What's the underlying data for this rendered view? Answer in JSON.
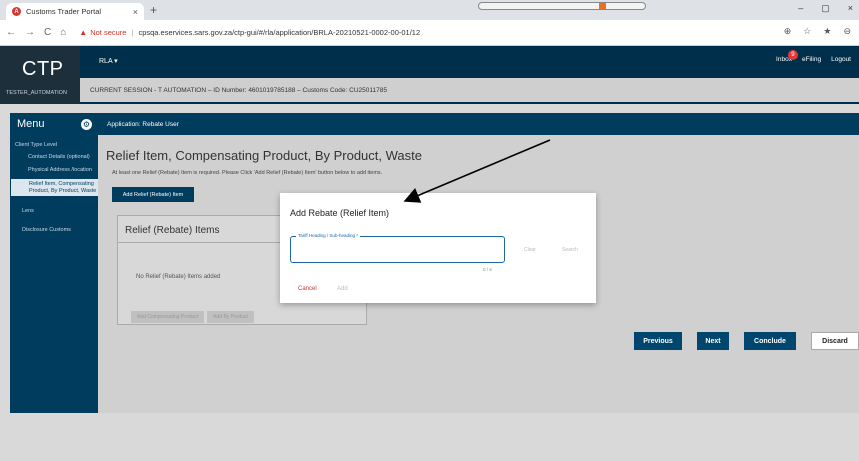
{
  "browser": {
    "tab_title": "Customs Trader Portal",
    "tab_close": "×",
    "new_tab": "+",
    "nav": [
      "←",
      "→",
      "C",
      "⌂"
    ],
    "not_secure": "Not secure",
    "separator": "|",
    "url": "cpsqa.eservices.sars.gov.za/ctp-gui/#/rla/application/BRLA-20210521-0002-00-01/12",
    "window_controls": [
      "–",
      "▢",
      "×"
    ],
    "right_icons": [
      "⊕",
      "☆",
      "★",
      "⊖"
    ]
  },
  "header": {
    "logo": "CTP",
    "user": "TESTER_AUTOMATION",
    "rla_menu": "RLA ▾",
    "inbox_label": "Inbox",
    "inbox_count": "9",
    "efiling": "eFiling",
    "logout": "Logout",
    "session_text": "CURRENT SESSION - T AUTOMATION – ID Number: 4601019785188 – Customs Code: CU25011785"
  },
  "menu": {
    "title": "Menu",
    "level": "Client Type Level",
    "items": [
      {
        "label": "Contact Details (optional)"
      },
      {
        "label": "Physical Address /location"
      },
      {
        "label": "Relief Item, Compensating Product, By Product, Waste"
      }
    ],
    "extra": [
      "Lens",
      "Disclosure Customs"
    ]
  },
  "content": {
    "application_label": "Application: Rebate User",
    "page_title": "Relief Item, Compensating Product, By Product, Waste",
    "hint": "At least one Relief (Rebate) Item is required. Please Click 'Add Relief (Rebate) Item' button below to add items.",
    "add_relief_button": "Add Relief (Rebate) Item",
    "items_card_title": "Relief (Rebate) Items",
    "empty_text": "No Relief (Rebate) Items added",
    "add_compensating": "Add Compensating Product",
    "add_by_product": "Add By Product",
    "previous": "Previous",
    "next": "Next",
    "conclude": "Conclude",
    "discard": "Discard"
  },
  "modal": {
    "title": "Add Rebate (Relief Item)",
    "field_label": "Tariff Heading / Sub-heading *",
    "field_value": "",
    "counter": "0 / 8",
    "clear": "Clear",
    "search": "Search",
    "cancel": "Cancel",
    "add": "Add"
  },
  "colors": {
    "header_bg": "#002f4b",
    "menu_bg": "#003c5e",
    "accent_red": "#d93025",
    "field_border": "#1c66a5"
  }
}
